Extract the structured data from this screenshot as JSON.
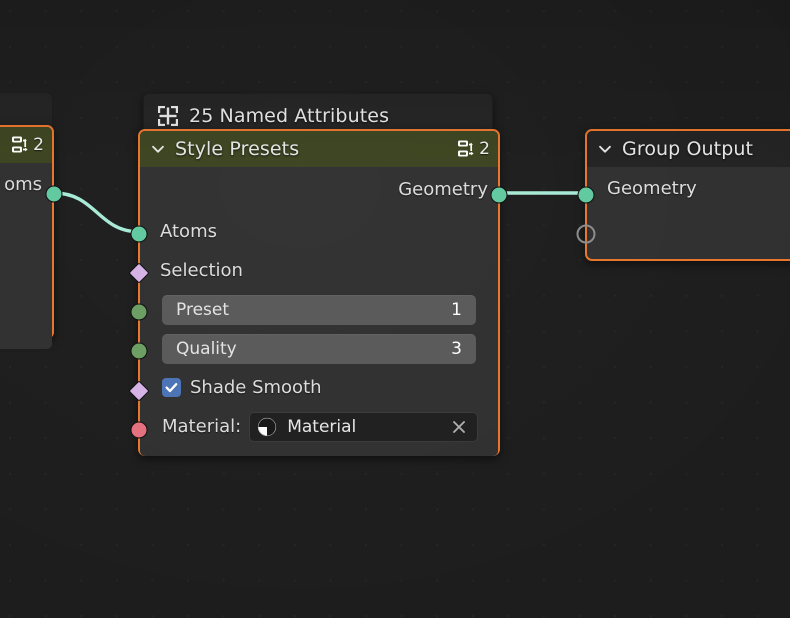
{
  "app": {
    "editor": "blender-geometry-node-editor",
    "background_color": "#1d1d1d"
  },
  "colors": {
    "selection_outline": "#e8762c",
    "geometry_header": "#3c4420",
    "plain_header": "#232323",
    "node_body": "#303030",
    "socket_geometry": "#63c9a0",
    "socket_boolean": "#d6b3e6",
    "socket_integer": "#6d9e63",
    "socket_material": "#e3717f",
    "socket_empty": "#8c8c8c",
    "field_background": "#595959",
    "checkbox_checked": "#4a73b5",
    "link_geometry": "#a9ead6"
  },
  "nodes": {
    "background_node": {
      "name": "background-node-partial",
      "visible_label": ""
    },
    "left_node": {
      "header_icon": "node-group-users-icon",
      "header_count": "2",
      "outputs": [
        {
          "label": "oms",
          "type": "geometry"
        }
      ]
    },
    "named_attributes_node": {
      "icon": "spreadsheet-grid-icon",
      "title": "25 Named Attributes"
    },
    "style_presets": {
      "title": "Style Presets",
      "collapse_icon": "chevron-down-icon",
      "header_icon": "node-group-users-icon",
      "header_count": "2",
      "outputs": [
        {
          "label": "Geometry",
          "type": "geometry"
        }
      ],
      "inputs": [
        {
          "label": "Atoms",
          "type": "geometry",
          "widget": "none"
        },
        {
          "label": "Selection",
          "type": "boolean",
          "widget": "none"
        },
        {
          "label": "Preset",
          "type": "integer",
          "widget": "value",
          "value": "1"
        },
        {
          "label": "Quality",
          "type": "integer",
          "widget": "value",
          "value": "3"
        },
        {
          "label": "Shade Smooth",
          "type": "boolean",
          "widget": "checkbox",
          "checked": true
        },
        {
          "label": "Material:",
          "type": "material",
          "widget": "material",
          "value": "Material",
          "icon": "material-sphere-icon",
          "clear_icon": "x-icon"
        }
      ]
    },
    "group_output": {
      "title": "Group Output",
      "collapse_icon": "chevron-down-icon",
      "inputs": [
        {
          "label": "Geometry",
          "type": "geometry"
        },
        {
          "label": "",
          "type": "empty"
        }
      ]
    }
  }
}
